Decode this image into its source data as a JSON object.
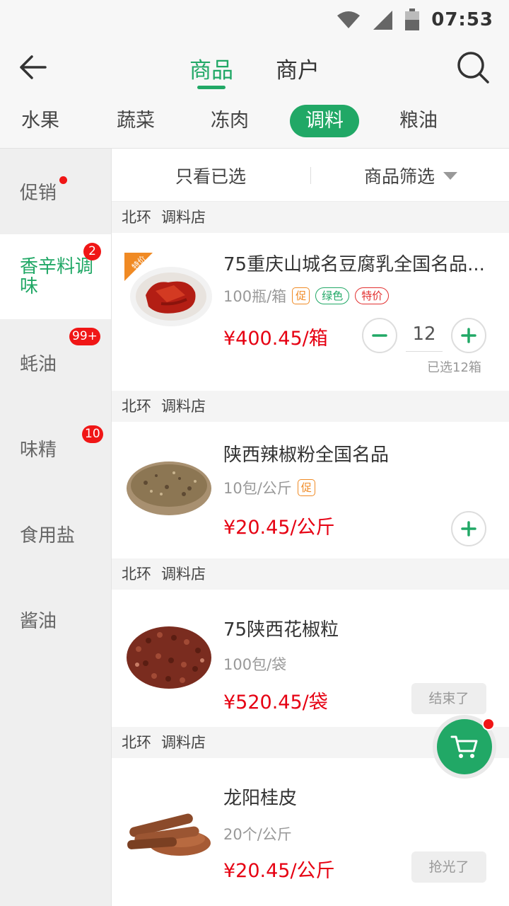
{
  "status": {
    "time": "07:53"
  },
  "header": {
    "tabs": [
      {
        "label": "商品",
        "active": true
      },
      {
        "label": "商户",
        "active": false
      }
    ]
  },
  "categories": [
    "水果",
    "蔬菜",
    "冻肉",
    "调料",
    "粮油"
  ],
  "active_category": "调料",
  "side": {
    "items": [
      {
        "label": "促销",
        "badge": "",
        "dot": true
      },
      {
        "label": "香辛料调味",
        "badge": "2",
        "active": true
      },
      {
        "label": "蚝油",
        "badge": "99+"
      },
      {
        "label": "味精",
        "badge": "10"
      },
      {
        "label": "食用盐",
        "badge": ""
      },
      {
        "label": "酱油",
        "badge": ""
      }
    ]
  },
  "filter": {
    "left": "只看已选",
    "right": "商品筛选"
  },
  "products": [
    {
      "store_area": "北环",
      "store_name": "调料店",
      "name": "75重庆山城名豆腐乳全国名品...",
      "spec": "100瓶/箱",
      "tags": [
        "促",
        "绿色",
        "特价"
      ],
      "corner_label": "特价",
      "price": "¥400.45/箱",
      "qty": "12",
      "selected_note": "已选12箱"
    },
    {
      "store_area": "北环",
      "store_name": "调料店",
      "name": "陕西辣椒粉全国名品",
      "spec": "10包/公斤",
      "tags": [
        "促"
      ],
      "price": "¥20.45/公斤"
    },
    {
      "store_area": "北环",
      "store_name": "调料店",
      "name": "75陕西花椒粒",
      "spec": "100包/袋",
      "tags": [],
      "price": "¥520.45/袋",
      "state": "结束了"
    },
    {
      "store_area": "北环",
      "store_name": "调料店",
      "name": "龙阳桂皮",
      "spec": "20个/公斤",
      "tags": [],
      "price": "¥20.45/公斤",
      "state": "抢光了"
    }
  ],
  "icons": {
    "back": "back-arrow-icon",
    "search": "search-icon",
    "cart": "cart-icon",
    "minus": "minus-icon",
    "plus": "plus-icon"
  },
  "colors": {
    "accent": "#21a866",
    "price": "#e60012",
    "badge": "#f01616"
  }
}
